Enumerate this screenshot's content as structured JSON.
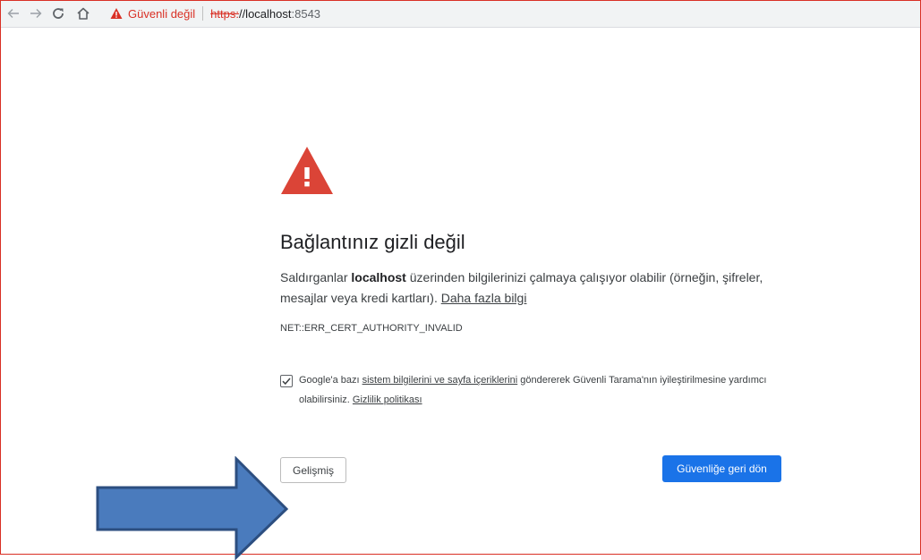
{
  "browser": {
    "security_label": "Güvenli değil",
    "url_scheme": "https:",
    "url_host": "//localhost",
    "url_port": ":8543",
    "nav_icons": [
      "back-icon",
      "forward-icon",
      "reload-icon",
      "home-icon"
    ]
  },
  "interstitial": {
    "title": "Bağlantınız gizli değil",
    "desc_before": "Saldırganlar ",
    "desc_host": "localhost",
    "desc_after": " üzerinden bilgilerinizi çalmaya çalışıyor olabilir (örneğin, şifreler, mesajlar veya kredi kartları). ",
    "learn_more": "Daha fazla bilgi",
    "error_code": "NET::ERR_CERT_AUTHORITY_INVALID",
    "optin_before": "Google'a bazı ",
    "optin_link": "sistem bilgilerini ve sayfa içeriklerini",
    "optin_after": " göndererek Güvenli Tarama'nın iyileştirilmesine yardımcı olabilirsiniz. ",
    "privacy_link": "Gizlilik politikası",
    "optin_checked": true,
    "advanced_button": "Gelişmiş",
    "back_button": "Güvenliğe geri dön"
  },
  "colors": {
    "warning_red": "#d93025",
    "primary_blue": "#1a73e8",
    "annotation_arrow_fill": "#4a7bbd",
    "annotation_arrow_stroke": "#2c4e80"
  }
}
